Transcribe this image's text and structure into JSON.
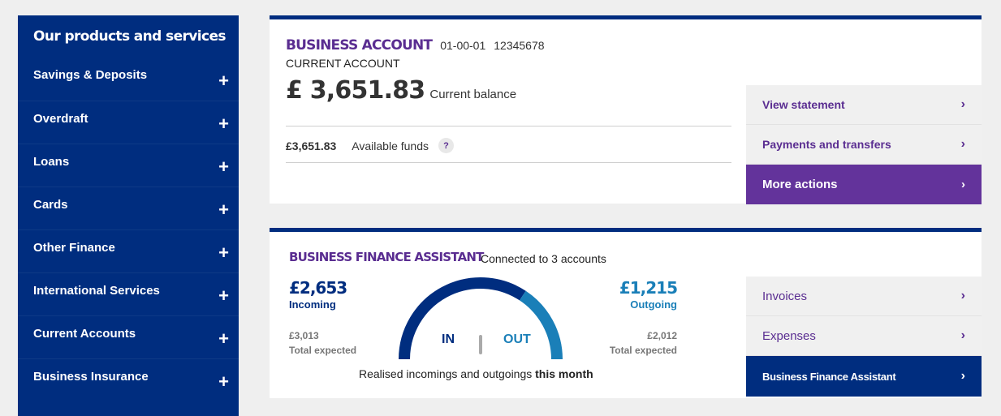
{
  "sidebar": {
    "title": "Our products and services",
    "items": [
      {
        "label": "Savings & Deposits"
      },
      {
        "label": "Overdraft"
      },
      {
        "label": "Loans"
      },
      {
        "label": "Cards"
      },
      {
        "label": "Other Finance"
      },
      {
        "label": "International Services"
      },
      {
        "label": "Current Accounts"
      },
      {
        "label": "Business Insurance"
      }
    ],
    "expand_glyph": "+"
  },
  "account": {
    "name": "BUSINESS ACCOUNT",
    "sort_code": "01-00-01",
    "account_number": "12345678",
    "type": "CURRENT ACCOUNT",
    "balance": "£ 3,651.83",
    "balance_label": "Current balance",
    "available_funds": "£3,651.83",
    "available_label": "Available funds",
    "help_glyph": "?",
    "actions": [
      {
        "label": "View statement"
      },
      {
        "label": "Payments and transfers"
      },
      {
        "label": "More actions"
      }
    ]
  },
  "bfa": {
    "title": "BUSINESS FINANCE ASSISTANT",
    "connected": "Connected to 3 accounts",
    "incoming": {
      "value": "£2,653",
      "label": "Incoming",
      "expected": "£3,013",
      "expected_label": "Total expected"
    },
    "outgoing": {
      "value": "£1,215",
      "label": "Outgoing",
      "expected": "£2,012",
      "expected_label": "Total expected"
    },
    "gauge": {
      "in_label": "IN",
      "out_label": "OUT",
      "in_amount": 2653,
      "out_amount": 1215,
      "in_color": "#002d7f",
      "out_color": "#1a7fb8"
    },
    "caption_main": "Realised incomings  and outgoings",
    "caption_bold": "this month",
    "actions": [
      {
        "label": "Invoices"
      },
      {
        "label": "Expenses"
      },
      {
        "label": "Business Finance Assistant"
      }
    ]
  },
  "colors": {
    "navy": "#002d7f",
    "purple": "#5a2d91",
    "purple_button": "#63339b",
    "teal": "#1a7fb8"
  },
  "icons": {
    "chevron": "chevron-right-icon",
    "plus": "plus-icon",
    "help": "help-icon"
  }
}
